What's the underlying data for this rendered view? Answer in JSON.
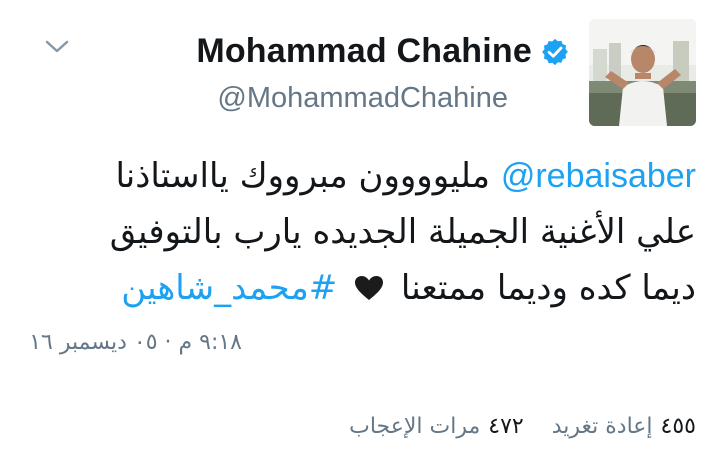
{
  "author": {
    "display_name": "Mohammad Chahine",
    "handle": "@MohammadChahine",
    "verified": true
  },
  "tweet": {
    "mention": "@rebaisaber",
    "line1_text": "مليوووون مبرووك يااستاذنا",
    "line2_text": "علي الأغنية الجميلة الجديده يارب بالتوفيق",
    "line3_text": "ديما كده وديما ممتعنا",
    "hashtag": "#محمد_شاهين"
  },
  "timestamp": "٩:١٨ م · ٠٥ ديسمبر ١٦",
  "stats": {
    "retweets_count": "٤٥٥",
    "retweets_label": "إعادة تغريد",
    "likes_count": "٤٧٢",
    "likes_label": "مرات الإعجاب"
  },
  "icons": {
    "menu": "chevron-down-icon",
    "verified": "verified-badge-icon",
    "heart": "heart-emoji-icon"
  },
  "colors": {
    "link": "#1da1f2",
    "verified": "#1da1f2",
    "secondary_text": "#657786",
    "primary_text": "#14171a"
  }
}
